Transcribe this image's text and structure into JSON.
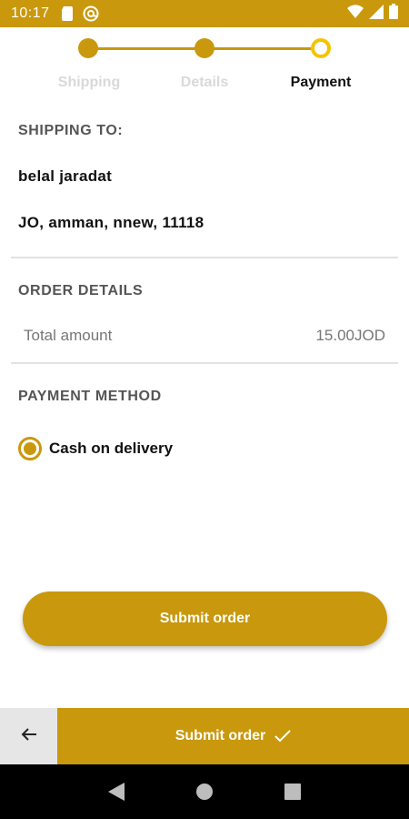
{
  "status_bar": {
    "time": "10:17",
    "icons": [
      "sim-card-icon",
      "at-sign-icon",
      "wifi-icon",
      "signal-icon",
      "battery-icon"
    ]
  },
  "stepper": {
    "steps": [
      {
        "label": "Shipping",
        "state": "done"
      },
      {
        "label": "Details",
        "state": "done"
      },
      {
        "label": "Payment",
        "state": "current"
      }
    ]
  },
  "shipping": {
    "title": "SHIPPING TO:",
    "name": "belal jaradat",
    "address": "JO, amman, nnew, 11118"
  },
  "order": {
    "title": "ORDER DETAILS",
    "total_label": "Total amount",
    "total_value": "15.00JOD"
  },
  "payment": {
    "title": "PAYMENT METHOD",
    "selected_option": "Cash on delivery"
  },
  "submit_button_label": "Submit order",
  "bottom_bar": {
    "back_icon": "arrow-left-icon",
    "submit_label": "Submit order",
    "submit_icon": "check-icon"
  },
  "nav_bar": {
    "buttons": [
      "back-triangle-icon",
      "home-circle-icon",
      "recents-square-icon"
    ]
  },
  "colors": {
    "accent": "#c9980d",
    "current_step_ring": "#f5c400",
    "inactive_step_label": "#d9d9d9"
  }
}
